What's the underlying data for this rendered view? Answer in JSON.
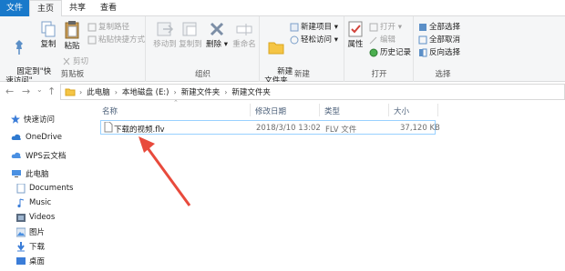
{
  "tabs": [
    "文件",
    "主页",
    "共享",
    "查看"
  ],
  "ribbon": {
    "clipboard": {
      "label": "剪贴板",
      "pin": "固定到\"快\n速访问\"",
      "copy": "复制",
      "paste": "粘贴",
      "cut": "剪切",
      "copy_path": "复制路径",
      "paste_shortcut": "粘贴快捷方式"
    },
    "organize": {
      "label": "组织",
      "move_to": "移动到",
      "copy_to": "复制到",
      "delete": "删除",
      "rename": "重命名"
    },
    "new": {
      "label": "新建",
      "new_folder": "新建\n文件夹",
      "new_item": "新建项目",
      "easy_access": "轻松访问"
    },
    "open": {
      "label": "打开",
      "properties": "属性",
      "open": "打开",
      "edit": "编辑",
      "history": "历史记录"
    },
    "select": {
      "label": "选择",
      "select_all": "全部选择",
      "select_none": "全部取消",
      "invert": "反向选择"
    }
  },
  "address": {
    "crumbs": [
      "此电脑",
      "本地磁盘 (E:)",
      "新建文件夹",
      "新建文件夹"
    ]
  },
  "nav": {
    "quick_access": "快速访问",
    "onedrive": "OneDrive",
    "wps": "WPS云文档",
    "this_pc": "此电脑",
    "documents": "Documents",
    "music": "Music",
    "videos": "Videos",
    "pictures": "图片",
    "downloads": "下载",
    "desktop": "桌面"
  },
  "columns": {
    "name": "名称",
    "date": "修改日期",
    "type": "类型",
    "size": "大小"
  },
  "files": [
    {
      "name": "下载的视频.flv",
      "date": "2018/3/10 13:02",
      "type": "FLV 文件",
      "size": "37,120 KB"
    }
  ],
  "colors": {
    "file_tab": "#1979ca",
    "annotation_arrow": "#e84a3c",
    "selection_border": "#99d1ff"
  }
}
